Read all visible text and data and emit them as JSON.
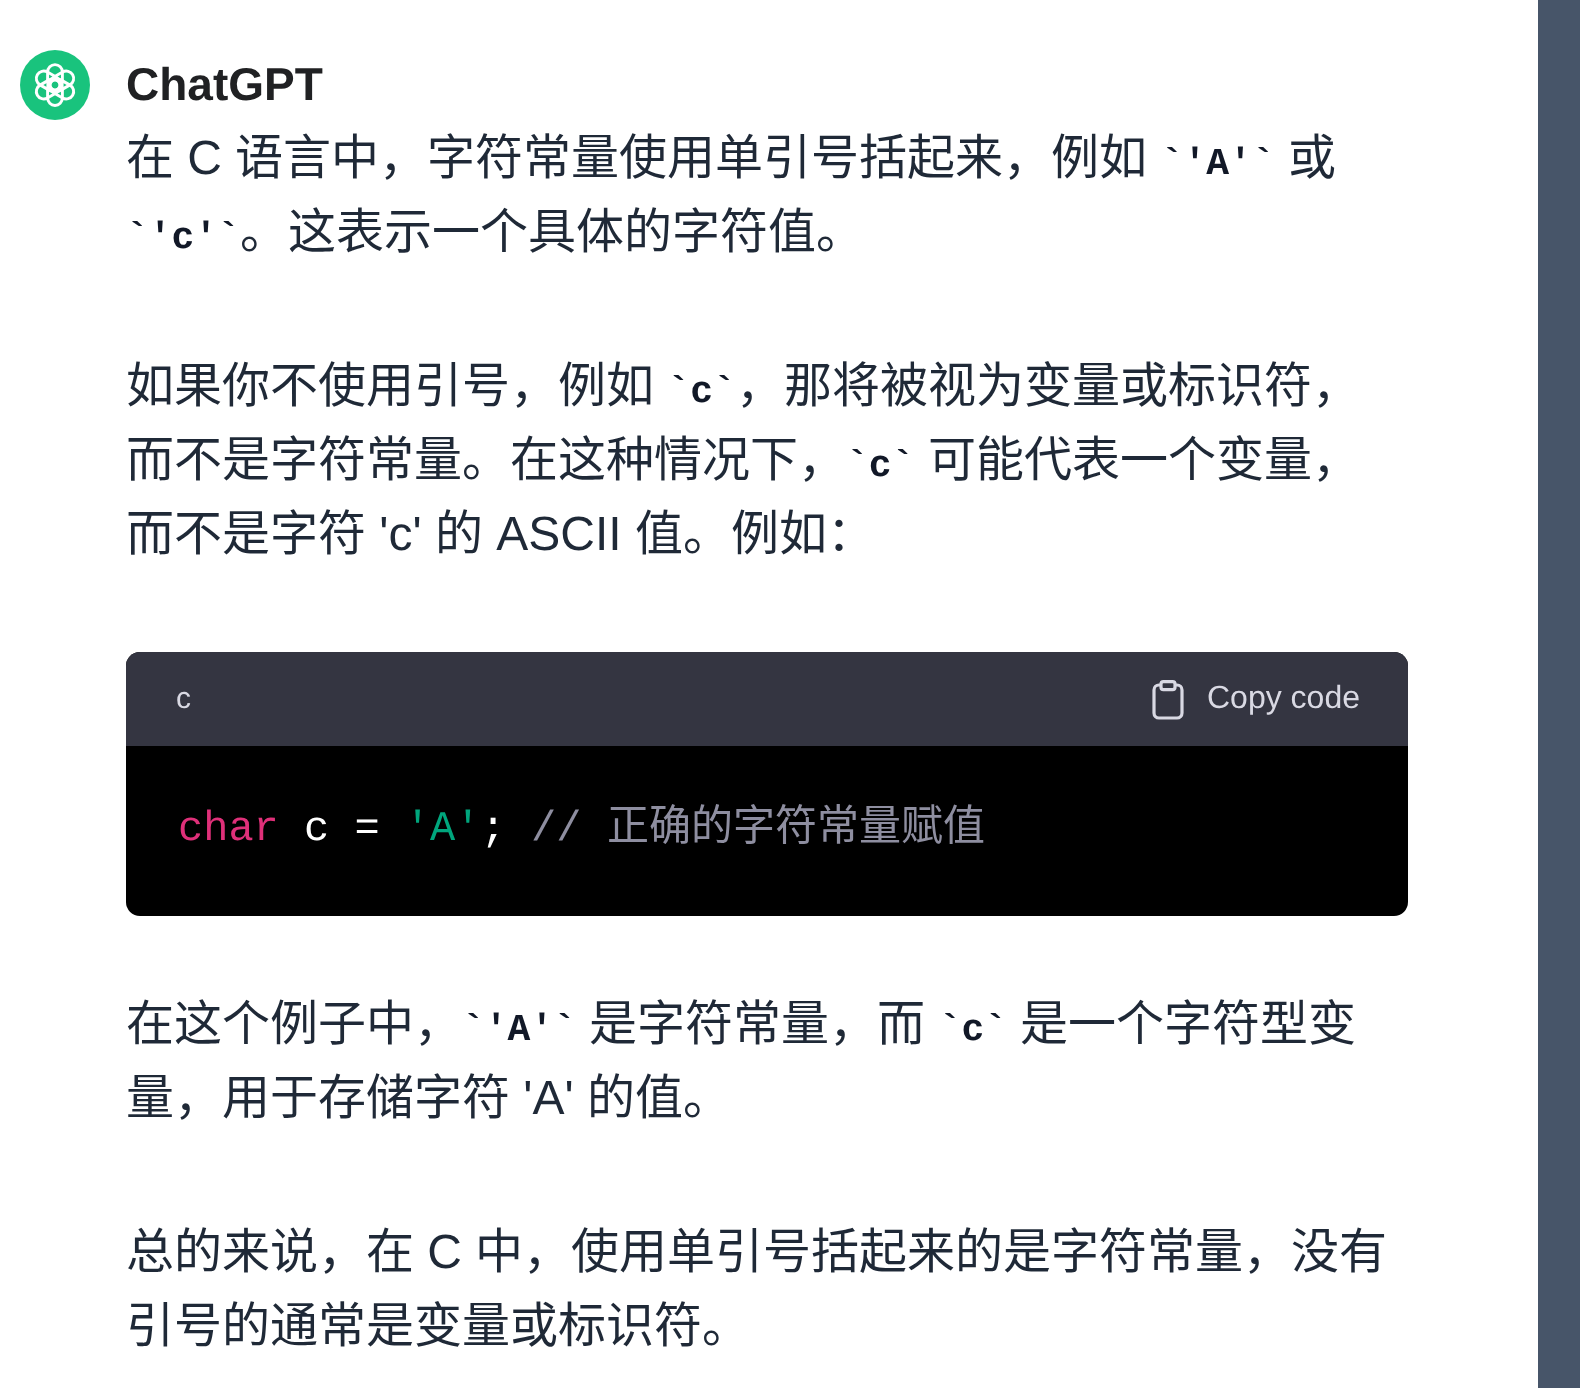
{
  "message": {
    "author": "ChatGPT",
    "blocks": [
      {
        "kind": "paragraph",
        "segments": [
          {
            "kind": "text",
            "text": "在 C 语言中，字符常量使用单引号括起来，例如 "
          },
          {
            "kind": "code",
            "text": "`'A'`"
          },
          {
            "kind": "text",
            "text": " 或 "
          },
          {
            "kind": "code",
            "text": "`'c'`"
          },
          {
            "kind": "text",
            "text": "。这表示一个具体的字符值。"
          }
        ]
      },
      {
        "kind": "paragraph",
        "segments": [
          {
            "kind": "text",
            "text": "如果你不使用引号，例如 "
          },
          {
            "kind": "code",
            "text": "`c`"
          },
          {
            "kind": "text",
            "text": "，那将被视为变量或标识符，而不是字符常量。在这种情况下，"
          },
          {
            "kind": "code",
            "text": "`c`"
          },
          {
            "kind": "text",
            "text": " 可能代表一个变量，而不是字符 'c' 的 ASCII 值。例如："
          }
        ]
      },
      {
        "kind": "code_block",
        "language": "c",
        "copy_label": "Copy code",
        "tokens": [
          {
            "kind": "keyword",
            "text": "char"
          },
          {
            "kind": "plain",
            "text": " c = "
          },
          {
            "kind": "string",
            "text": "'A'"
          },
          {
            "kind": "plain",
            "text": "; "
          },
          {
            "kind": "comment",
            "text": "// 正确的字符常量赋值"
          }
        ]
      },
      {
        "kind": "paragraph",
        "segments": [
          {
            "kind": "text",
            "text": "在这个例子中，"
          },
          {
            "kind": "code",
            "text": "`'A'`"
          },
          {
            "kind": "text",
            "text": " 是字符常量，而 "
          },
          {
            "kind": "code",
            "text": "`c`"
          },
          {
            "kind": "text",
            "text": " 是一个字符型变量，用于存储字符 'A' 的值。"
          }
        ]
      },
      {
        "kind": "paragraph",
        "segments": [
          {
            "kind": "text",
            "text": "总的来说，在 C 中，使用单引号括起来的是字符常量，没有引号的通常是变量或标识符。"
          }
        ]
      }
    ]
  }
}
